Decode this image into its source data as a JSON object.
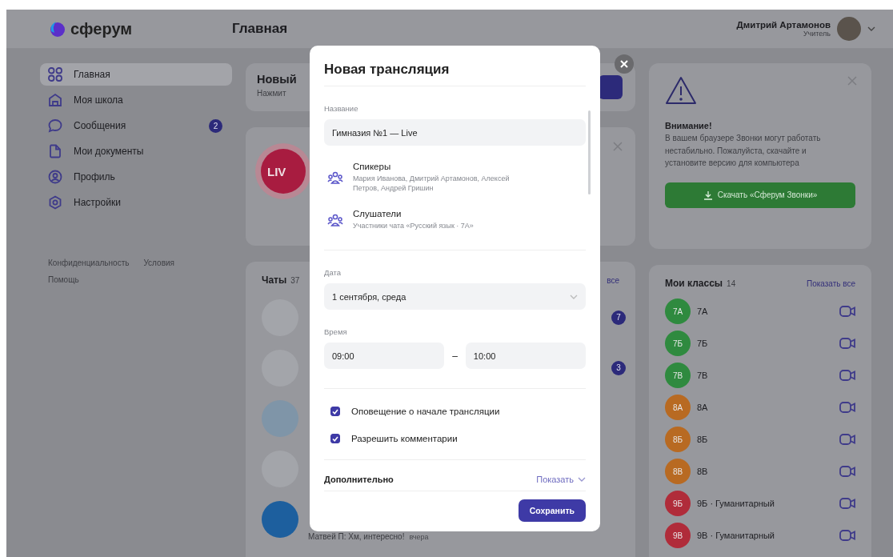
{
  "header": {
    "logo": "сферум",
    "title": "Главная",
    "user_name": "Дмитрий Артамонов",
    "user_role": "Учитель"
  },
  "sidebar": {
    "items": [
      {
        "label": "Главная",
        "kind": "grid",
        "selected": true
      },
      {
        "label": "Моя школа",
        "kind": "school",
        "selected": false
      },
      {
        "label": "Сообщения",
        "kind": "chat",
        "selected": false,
        "badge": "2"
      },
      {
        "label": "Мои документы",
        "kind": "document",
        "selected": false
      },
      {
        "label": "Профиль",
        "kind": "profile",
        "selected": false
      },
      {
        "label": "Настройки",
        "kind": "settings",
        "selected": false
      }
    ],
    "footer_links": [
      "Конфиденциальность",
      "Условия",
      "Помощь"
    ]
  },
  "broadcast_card": {
    "title": "Новый",
    "subtitle": "Нажмит"
  },
  "live_card": {
    "badge": "LIV"
  },
  "chats": {
    "title": "Чаты",
    "count": "37",
    "show_all": "все",
    "items": [
      {
        "kind": "runner",
        "unread": "7"
      },
      {
        "kind": "burst",
        "unread": "3"
      },
      {
        "kind": "book"
      },
      {
        "kind": "book-plain"
      },
      {
        "kind": "book-blue",
        "preview": "Матвей П: Хм, интересно!",
        "time": "вчера"
      }
    ]
  },
  "warning": {
    "title": "Внимание!",
    "text": "В вашем браузере Звонки могут работать нестабильно. Пожалуйста, скачайте и установите версию для компьютера",
    "button": "Скачать «Сферум Звонки»"
  },
  "classes": {
    "title": "Мои классы",
    "count": "14",
    "show_all": "Показать все",
    "items": [
      {
        "badge": "7А",
        "name": "7А",
        "color": "#2f8a3f"
      },
      {
        "badge": "7Б",
        "name": "7Б",
        "color": "#2f8a3f"
      },
      {
        "badge": "7В",
        "name": "7В",
        "color": "#2f8a3f"
      },
      {
        "badge": "8А",
        "name": "8А",
        "color": "#b86a22"
      },
      {
        "badge": "8Б",
        "name": "8Б",
        "color": "#b86a22"
      },
      {
        "badge": "8В",
        "name": "8В",
        "color": "#b86a22"
      },
      {
        "badge": "9Б",
        "name": "9Б · Гуманитарный",
        "color": "#b02c3a"
      },
      {
        "badge": "9В",
        "name": "9В · Гуманитарный",
        "color": "#b02c3a"
      }
    ]
  },
  "modal": {
    "title": "Новая трансляция",
    "name_label": "Название",
    "name_value": "Гимназия №1 — Live",
    "participants": [
      {
        "title": "Спикеры",
        "subtitle": "Мария Иванова, Дмитрий Артамонов, Алексей Петров, Андрей Гришин"
      },
      {
        "title": "Слушатели",
        "subtitle": "Участники чата «Русский язык · 7А»"
      }
    ],
    "date_label": "Дата",
    "date_value": "1 сентября, среда",
    "time_label": "Время",
    "time_from": "09:00",
    "time_separator": "–",
    "time_to": "10:00",
    "checkboxes": [
      {
        "label": "Оповещение о начале трансляции",
        "checked": true
      },
      {
        "label": "Разрешить комментарии",
        "checked": true
      }
    ],
    "extra_label": "Дополнительно",
    "extra_toggle": "Показать",
    "save": "Сохранить"
  }
}
